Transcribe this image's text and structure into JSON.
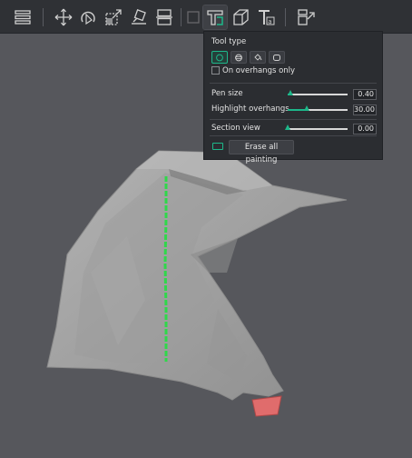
{
  "toolbar": {
    "buttons": [
      {
        "name": "arrange-icon"
      },
      {
        "name": "move-icon"
      },
      {
        "name": "rotate-icon"
      },
      {
        "name": "scale-icon"
      },
      {
        "name": "lay-on-face-icon"
      },
      {
        "name": "cut-icon"
      },
      {
        "name": "support-painting-icon",
        "active": true
      },
      {
        "name": "seam-painting-icon"
      },
      {
        "name": "text-tool-icon"
      },
      {
        "name": "assembly-icon"
      }
    ]
  },
  "panel": {
    "tool_type_label": "Tool type",
    "tools": [
      "circle-tool-icon",
      "sphere-tool-icon",
      "fill-tool-icon",
      "gap-fill-tool-icon"
    ],
    "on_overhangs_only_label": "On overhangs only",
    "on_overhangs_only_checked": false,
    "pen_size_label": "Pen size",
    "pen_size_value": "0.40",
    "pen_size_fraction": 0.05,
    "highlight_overhangs_label": "Highlight overhangs",
    "highlight_overhangs_value": "30.00",
    "highlight_overhangs_fraction": 0.33,
    "section_view_label": "Section view",
    "section_view_value": "0.00",
    "section_view_fraction": 0.0,
    "erase_all_label": "Erase all painting"
  },
  "colors": {
    "accent": "#1db88a",
    "background": "#56575c",
    "model": "#a3a3a3",
    "support_paint": "#2fd84a",
    "selected_face": "#e06c6c"
  }
}
